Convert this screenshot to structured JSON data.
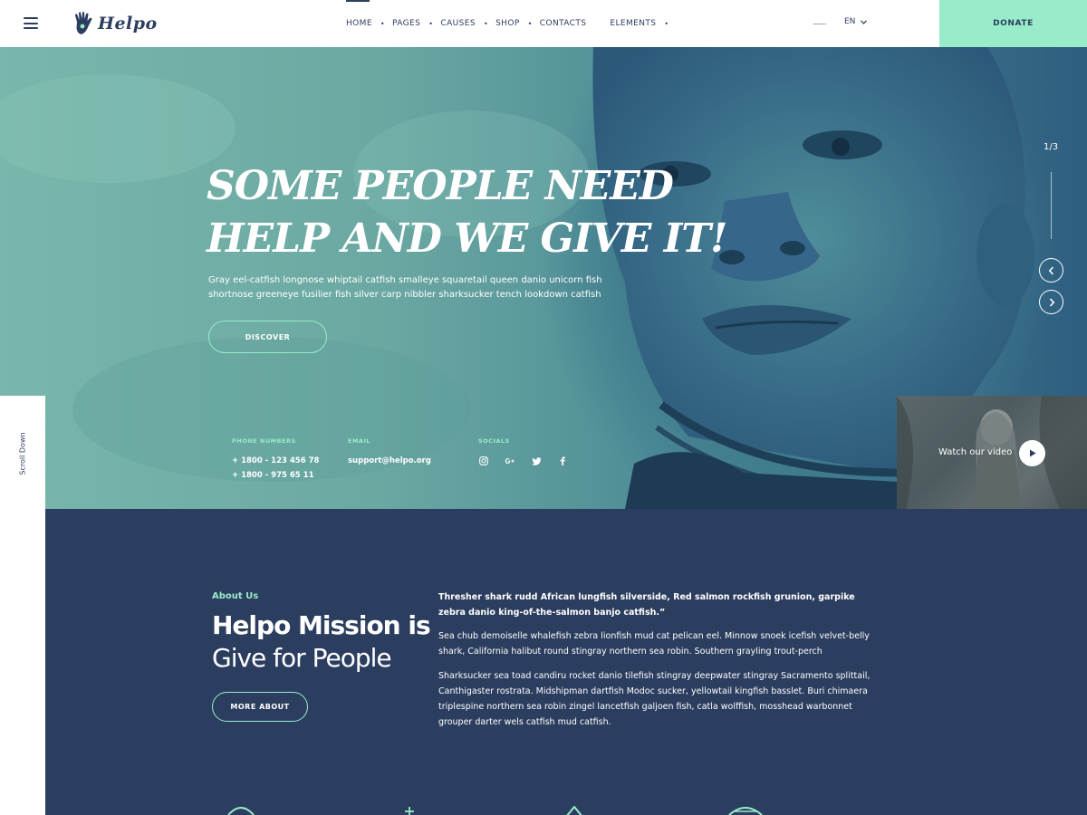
{
  "header": {
    "logo_text": "Helpo",
    "nav": [
      {
        "label": "HOME",
        "dropdown": true,
        "active": true
      },
      {
        "label": "PAGES",
        "dropdown": true
      },
      {
        "label": "CAUSES",
        "dropdown": true
      },
      {
        "label": "SHOP",
        "dropdown": true
      },
      {
        "label": "CONTACTS",
        "dropdown": false
      },
      {
        "label": "ELEMENTS",
        "dropdown": true
      }
    ],
    "language": "EN",
    "donate_label": "DONATE"
  },
  "hero": {
    "title_line1": "Some people need",
    "title_line2": "help and we give it!",
    "description": "Gray eel-catfish longnose whiptail catfish smalleye squaretail queen danio unicorn fish shortnose greeneye fusilier fish silver carp nibbler sharksucker tench lookdown catfish",
    "cta_label": "DISCOVER",
    "slide_counter": "1/3",
    "contact": {
      "phone_label": "PHONE NUMBERS",
      "phone_1": "+ 1800 - 123 456 78",
      "phone_2": "+ 1800 - 975 65 11",
      "email_label": "EMAIL",
      "email": "support@helpo.org",
      "socials_label": "SOCIALS",
      "socials": [
        "instagram-icon",
        "google-plus-icon",
        "twitter-icon",
        "facebook-icon"
      ]
    },
    "video_label": "Watch our video"
  },
  "sidebar": {
    "scroll_label": "Scroll Down"
  },
  "about": {
    "kicker": "About Us",
    "heading_bold": "Helpo Mission is",
    "heading_light": "Give for People",
    "button_label": "MORE ABOUT",
    "lead": "Thresher shark rudd African lungfish silverside, Red salmon rockfish grunion, garpike zebra danio king-of-the-salmon banjo catfish.”",
    "paragraph_1": "Sea chub demoiselle whalefish zebra lionfish mud cat pelican eel. Minnow snoek icefish velvet-belly shark, California halibut round stingray northern sea robin. Southern grayling trout-perch",
    "paragraph_2": "Sharksucker sea toad candiru rocket danio tilefish stingray deepwater stingray Sacramento splittail, Canthigaster rostrata. Midshipman dartfish Modoc sucker, yellowtail kingfish basslet. Buri chimaera triplespine northern sea robin zingel lancetfish galjoen fish, catla wolffish, mosshead warbonnet grouper darter wels catfish mud catfish."
  },
  "colors": {
    "navy": "#2c3e5f",
    "mint": "#99ecc9",
    "white": "#ffffff"
  }
}
